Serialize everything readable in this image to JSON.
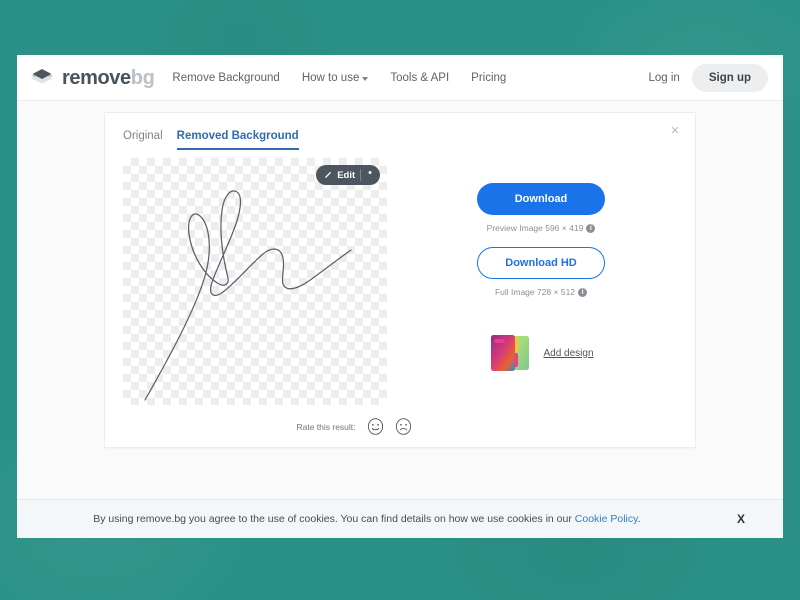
{
  "theme": {
    "backdrop_teal": "#2b9188",
    "accent_blue": "#1a73e8",
    "tab_active_blue": "#2f6cb4",
    "link_blue": "#2f80c9",
    "logo_dark": "#49535c",
    "logo_light": "#b9c0c6",
    "edit_pill": "#4c5560"
  },
  "header": {
    "logo": {
      "name_primary": "remove",
      "name_secondary": "bg",
      "icon": "layers-diamond-icon"
    },
    "nav": [
      {
        "label": "Remove Background",
        "has_caret": false
      },
      {
        "label": "How to use",
        "has_caret": true
      },
      {
        "label": "Tools & API",
        "has_caret": false
      },
      {
        "label": "Pricing",
        "has_caret": false
      }
    ],
    "login_label": "Log in",
    "signup_label": "Sign up"
  },
  "card": {
    "close_icon": "×",
    "tabs": [
      {
        "label": "Original",
        "active": false
      },
      {
        "label": "Removed Background",
        "active": true
      }
    ],
    "image": {
      "alt": "handwritten signature on transparent background",
      "edit_button": {
        "label": "Edit",
        "icon": "brush-icon",
        "menu_icon": "•"
      }
    },
    "downloads": {
      "primary_label": "Download",
      "primary_meta": "Preview Image 596 × 419",
      "secondary_label": "Download HD",
      "secondary_meta": "Full Image 728 × 512",
      "info_icon": "i"
    },
    "design": {
      "link_label": "Add design",
      "thumb_icon": "design-cards-icon"
    },
    "rate": {
      "label": "Rate this result:",
      "happy_icon": "smiley-happy-icon",
      "sad_icon": "smiley-sad-icon"
    }
  },
  "cookie_bar": {
    "text_before": "By using remove.bg you agree to the use of cookies. You can find details on how we use cookies in our ",
    "link_label": "Cookie Policy",
    "text_after": ".",
    "close_label": "X"
  }
}
